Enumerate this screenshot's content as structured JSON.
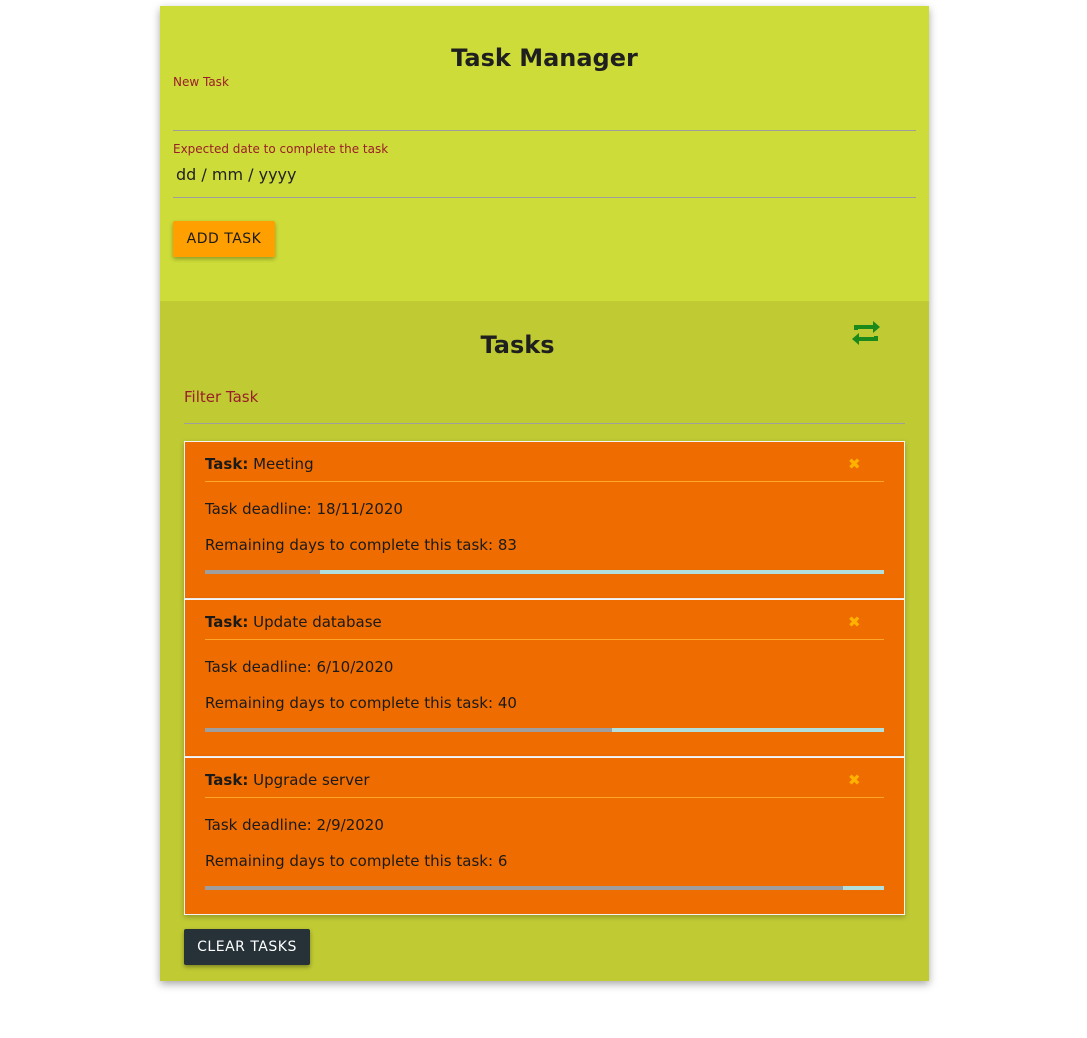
{
  "app": {
    "title": "Task Manager"
  },
  "form": {
    "new_task_label": "New Task",
    "new_task_value": "",
    "date_label": "Expected date to complete the task",
    "date_value": "dd / mm / yyyy",
    "add_button_label": "ADD TASK"
  },
  "tasks_section": {
    "title": "Tasks",
    "refresh_icon": "refresh-icon",
    "filter_placeholder": "Filter Task",
    "clear_button_label": "CLEAR TASKS"
  },
  "task_labels": {
    "task_prefix": "Task:",
    "deadline_prefix": "Task deadline:",
    "remaining_prefix": "Remaining days to complete this task:"
  },
  "tasks": [
    {
      "name": "Meeting",
      "deadline": "18/11/2020",
      "remaining_days": "83",
      "elapsed_fraction": 0.17
    },
    {
      "name": "Update database",
      "deadline": "6/10/2020",
      "remaining_days": "40",
      "elapsed_fraction": 0.6
    },
    {
      "name": "Upgrade server",
      "deadline": "2/9/2020",
      "remaining_days": "6",
      "elapsed_fraction": 0.94
    }
  ],
  "colors": {
    "top_panel": "#cddc39",
    "tasks_panel": "#c0ca33",
    "task_card": "#ef6c00",
    "add_button": "#ffa000",
    "clear_button": "#263238",
    "refresh_icon": "#1b8a1b"
  }
}
